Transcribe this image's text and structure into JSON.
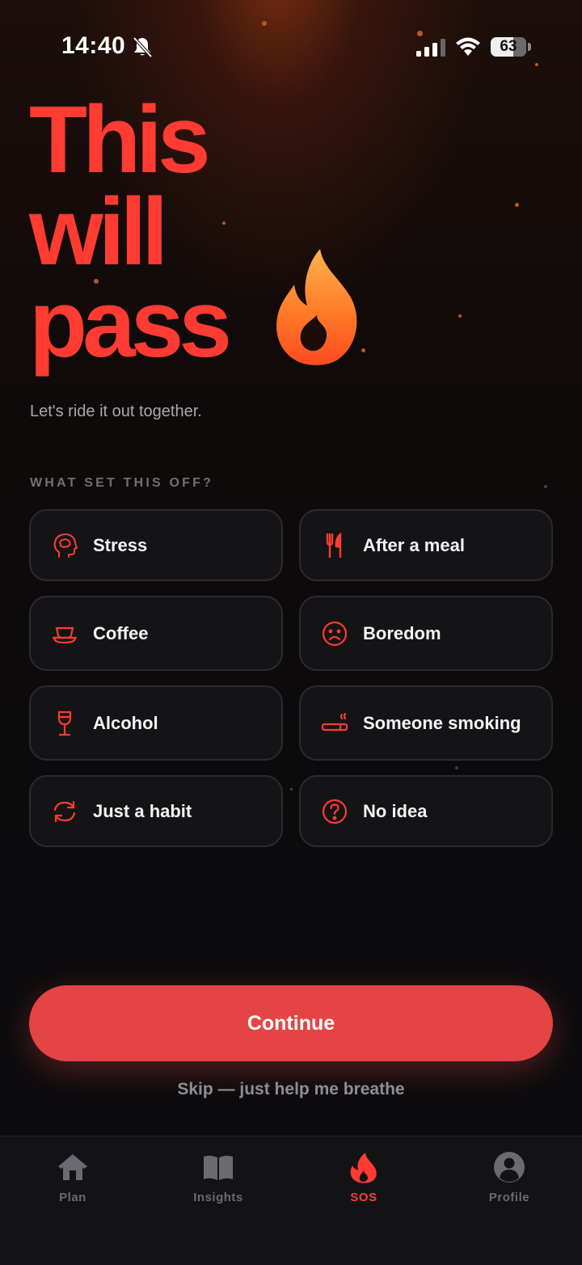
{
  "status_bar": {
    "time": "14:40",
    "battery": "63",
    "battery_level": 0.63
  },
  "hero": {
    "title_lines": [
      "This",
      "will",
      "pass"
    ],
    "subtitle": "Let's ride it out together."
  },
  "triggers": {
    "label": "WHAT SET THIS OFF?",
    "options": [
      {
        "label": "Stress",
        "icon": "head-brain-icon"
      },
      {
        "label": "After a meal",
        "icon": "fork-knife-icon"
      },
      {
        "label": "Coffee",
        "icon": "coffee-cup-icon"
      },
      {
        "label": "Boredom",
        "icon": "sad-face-icon"
      },
      {
        "label": "Alcohol",
        "icon": "wine-glass-icon"
      },
      {
        "label": "Someone smoking",
        "icon": "cigarette-icon"
      },
      {
        "label": "Just a habit",
        "icon": "repeat-icon"
      },
      {
        "label": "No idea",
        "icon": "question-icon"
      }
    ]
  },
  "actions": {
    "continue_label": "Continue",
    "skip_label": "Skip — just help me breathe"
  },
  "tab_bar": {
    "items": [
      {
        "label": "Plan",
        "icon": "house-icon"
      },
      {
        "label": "Insights",
        "icon": "book-icon"
      },
      {
        "label": "SOS",
        "icon": "flame-icon",
        "active": true
      },
      {
        "label": "Profile",
        "icon": "person-icon"
      }
    ]
  },
  "colors": {
    "accent": "#ff3b32",
    "button": "#e54444",
    "background": "#0b0b0d",
    "card": "#141416"
  }
}
